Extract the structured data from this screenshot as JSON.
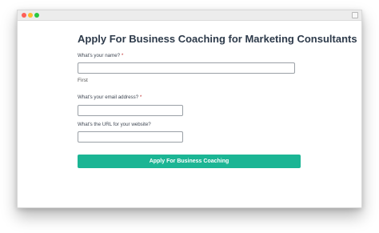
{
  "form": {
    "title": "Apply For Business Coaching for Marketing Consultants",
    "name_label": "What's your name?",
    "name_sublabel": "First",
    "email_label": "What's your email address?",
    "url_label": "What's the URL for your website?",
    "required_mark": "*",
    "name_value": "",
    "email_value": "",
    "url_value": "",
    "submit_label": "Apply For Business Coaching"
  },
  "colors": {
    "accent": "#1bb594",
    "title_text": "#2d3a4a",
    "window_close": "#fe5f57",
    "window_minimize": "#febc2e",
    "window_zoom": "#28c840"
  }
}
